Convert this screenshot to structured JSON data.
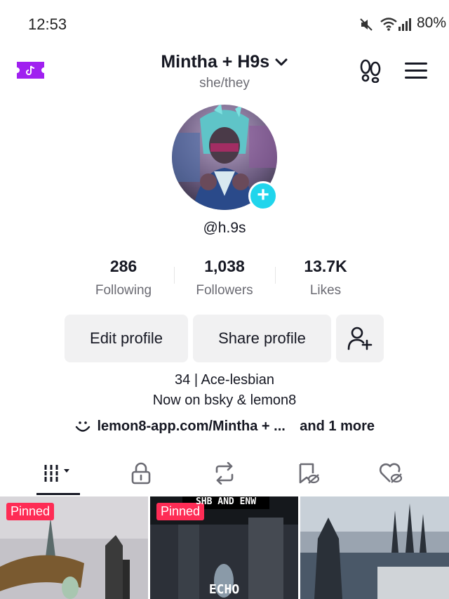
{
  "status_bar": {
    "time": "12:53",
    "battery": "80%",
    "icons": [
      "mute-icon",
      "wifi-icon",
      "signal-icon",
      "battery-icon"
    ]
  },
  "header": {
    "name": "Mintha + H9s",
    "pronouns": "she/they"
  },
  "profile": {
    "username": "@h.9s"
  },
  "stats": [
    {
      "value": "286",
      "label": "Following"
    },
    {
      "value": "1,038",
      "label": "Followers"
    },
    {
      "value": "13.7K",
      "label": "Likes"
    }
  ],
  "buttons": {
    "edit": "Edit profile",
    "share": "Share profile"
  },
  "bio": {
    "line1": "34 | Ace-lesbian",
    "line2": "Now on bsky & lemon8",
    "link": "lemon8-app.com/Mintha + ...",
    "more": "and 1 more"
  },
  "tabs": [
    "videos-grid-icon",
    "lock-icon",
    "repost-icon",
    "saved-icon",
    "liked-icon"
  ],
  "grid": [
    {
      "pinned": "Pinned",
      "overlay_top": "",
      "overlay_bottom": ""
    },
    {
      "pinned": "Pinned",
      "overlay_top": "SHB AND ENW",
      "overlay_bottom": "ECHO"
    },
    {
      "pinned": "",
      "overlay_top": "",
      "overlay_bottom": ""
    }
  ],
  "colors": {
    "accent": "#fe2c55",
    "add_badge": "#20d5ec",
    "ticket": "#a020f0"
  }
}
